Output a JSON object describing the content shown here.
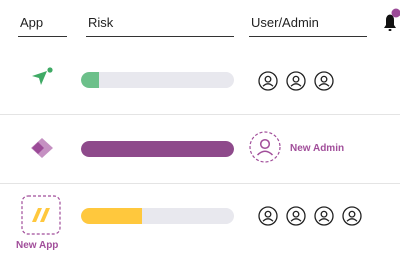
{
  "header": {
    "app": "App",
    "risk": "Risk",
    "user_admin": "User/Admin"
  },
  "rows": [
    {
      "app_icon": "send-icon",
      "risk_value": 0.12,
      "risk_color": "#6cc08a",
      "users": 3
    },
    {
      "app_icon": "diamond-icon",
      "risk_value": 1.0,
      "risk_color": "#8e4a8b",
      "new_admin_label": "New Admin"
    },
    {
      "app_icon": "slash-app-icon",
      "new_app_label": "New App",
      "risk_value": 0.4,
      "risk_color": "#ffc83d",
      "users": 4
    }
  ],
  "colors": {
    "accent": "#a14e9a",
    "notification_dot": "#9b4a97"
  }
}
